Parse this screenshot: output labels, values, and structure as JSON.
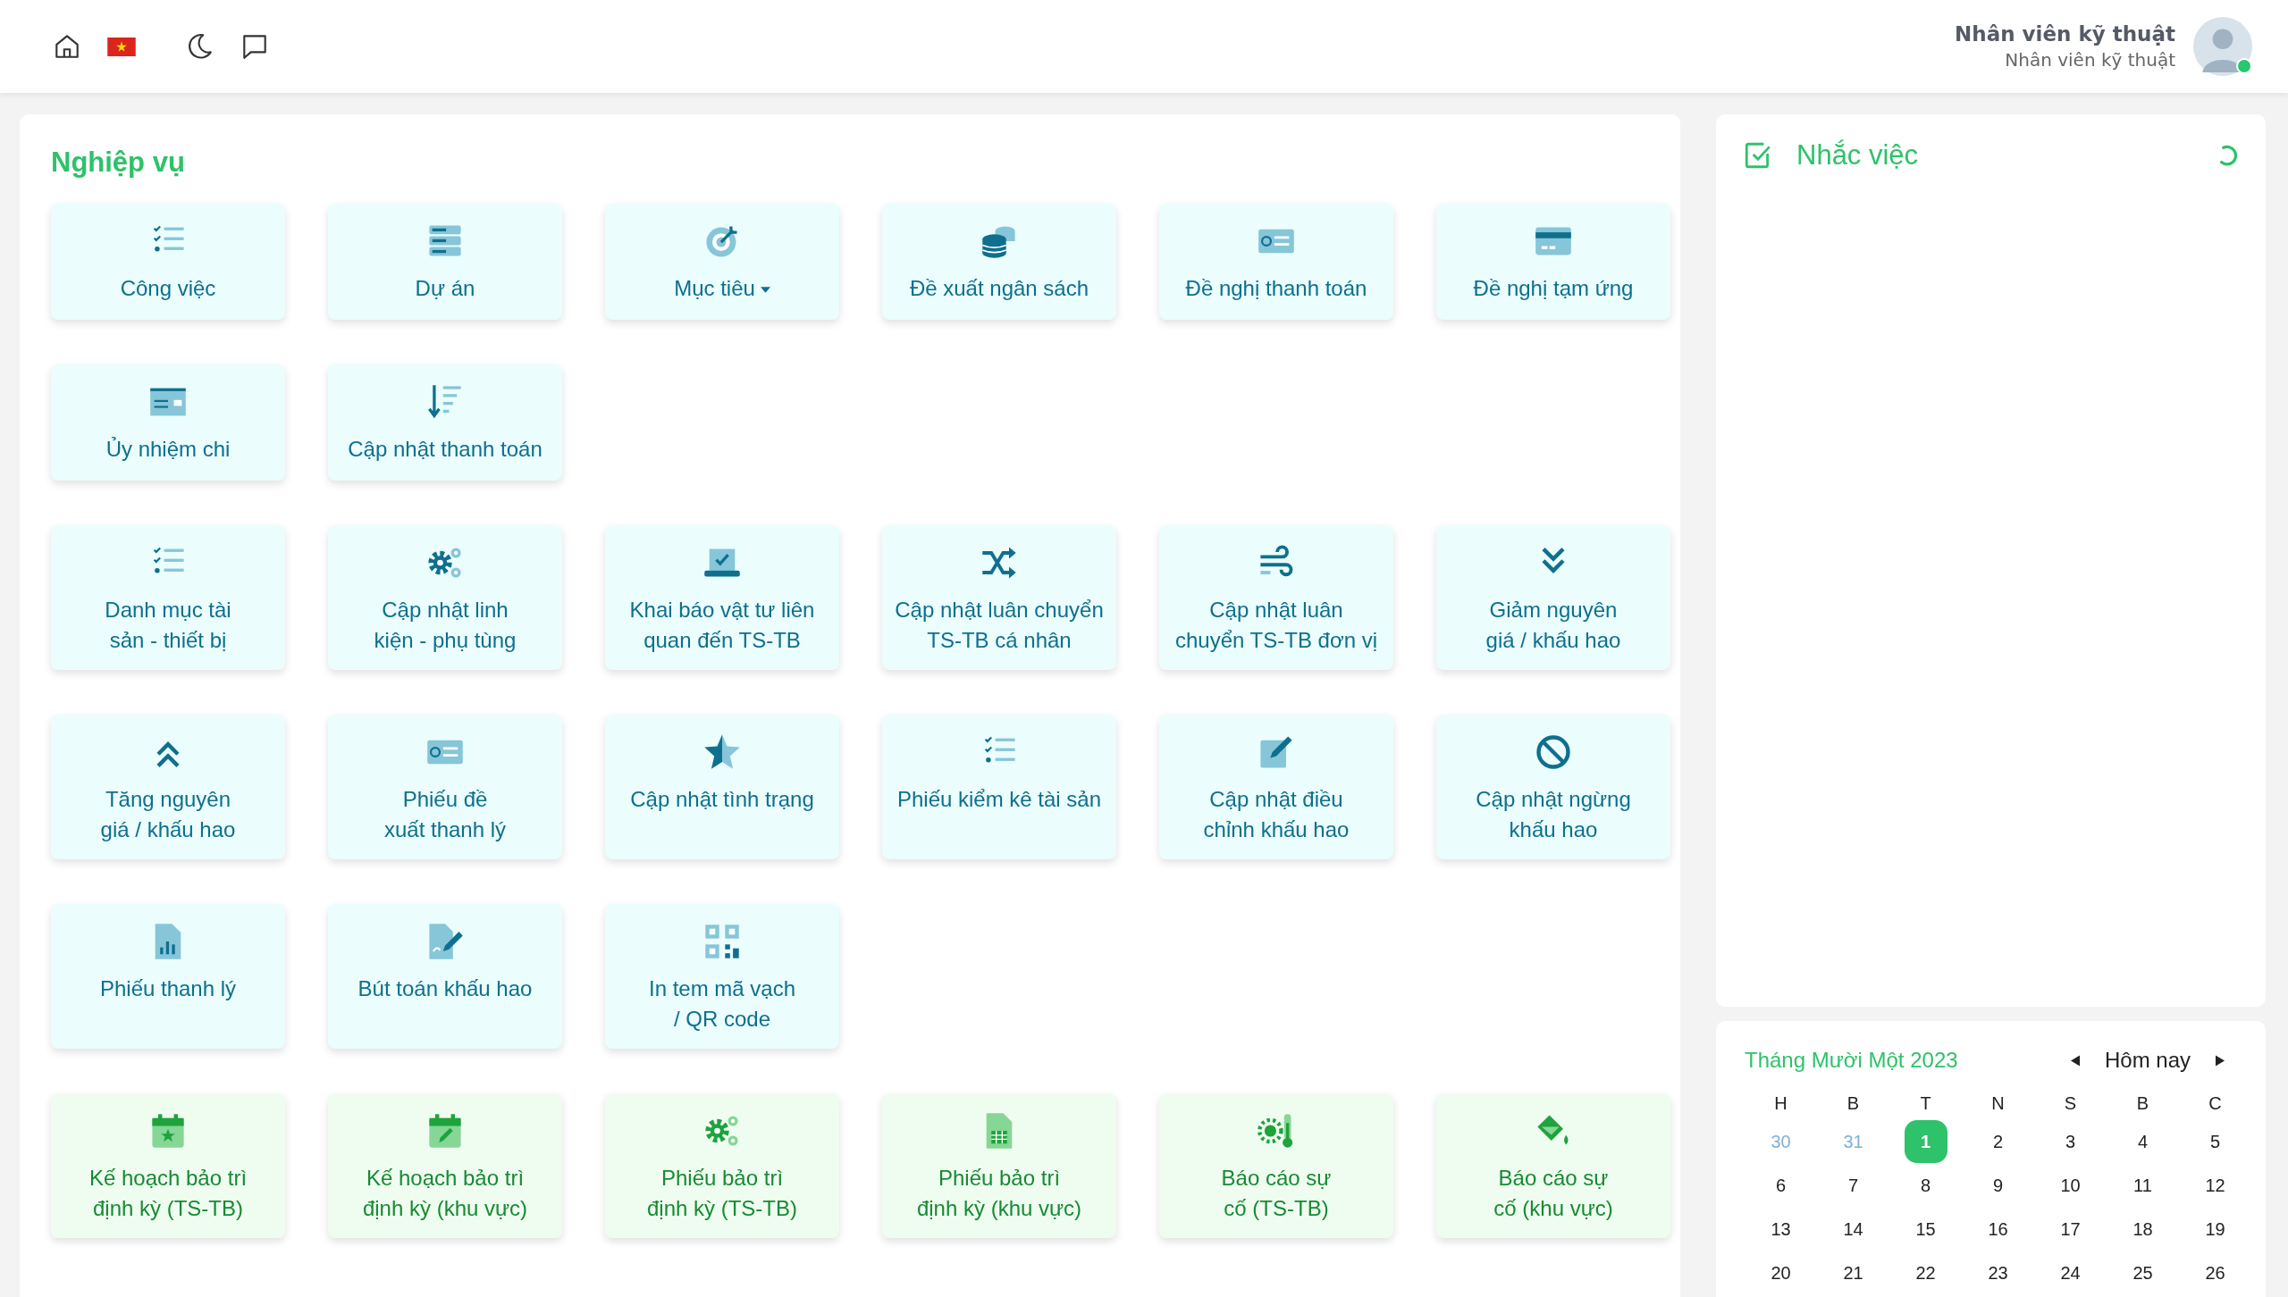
{
  "header": {
    "user_name": "Nhân viên kỹ thuật",
    "user_role": "Nhân viên kỹ thuật",
    "online": true
  },
  "main": {
    "title": "Nghiệp vụ",
    "groups": [
      {
        "kind": "finance",
        "tiles": [
          {
            "label": "Công việc",
            "dropdown": false
          },
          {
            "label": "Dự án",
            "dropdown": false
          },
          {
            "label": "Mục tiêu",
            "dropdown": true
          },
          {
            "label": "Đề xuất ngân sách",
            "dropdown": false
          },
          {
            "label": "Đề nghị thanh toán",
            "dropdown": false
          },
          {
            "label": "Đề nghị tạm ứng",
            "dropdown": false
          },
          {
            "label": "Ủy nhiệm chi",
            "dropdown": false
          },
          {
            "label": "Cập nhật thanh toán",
            "dropdown": false
          }
        ]
      },
      {
        "kind": "asset",
        "tiles": [
          {
            "label": "Danh mục tài\nsản - thiết bị",
            "dropdown": false
          },
          {
            "label": "Cập nhật linh\nkiện - phụ tùng",
            "dropdown": false
          },
          {
            "label": "Khai báo vật tư liên\nquan đến TS-TB",
            "dropdown": false
          },
          {
            "label": "Cập nhật luân chuyển\nTS-TB cá nhân",
            "dropdown": false
          },
          {
            "label": "Cập nhật luân\nchuyển TS-TB đơn vị",
            "dropdown": false
          },
          {
            "label": "Giảm nguyên\ngiá / khấu hao",
            "dropdown": false
          },
          {
            "label": "Tăng nguyên\ngiá / khấu hao",
            "dropdown": false
          },
          {
            "label": "Phiếu đề\nxuất thanh lý",
            "dropdown": false
          },
          {
            "label": "Cập nhật tình trạng",
            "dropdown": false
          },
          {
            "label": "Phiếu kiểm kê tài sản",
            "dropdown": false
          },
          {
            "label": "Cập nhật điều\nchỉnh khấu hao",
            "dropdown": false
          },
          {
            "label": "Cập nhật ngừng\nkhấu hao",
            "dropdown": false
          },
          {
            "label": "Phiếu thanh lý",
            "dropdown": false
          },
          {
            "label": "Bút toán khấu hao",
            "dropdown": false
          },
          {
            "label": "In tem mã vạch\n/ QR code",
            "dropdown": false
          }
        ]
      },
      {
        "kind": "maintenance",
        "tiles": [
          {
            "label": "Kế hoạch bảo trì\nđịnh kỳ (TS-TB)",
            "dropdown": false
          },
          {
            "label": "Kế hoạch bảo trì\nđịnh kỳ (khu vực)",
            "dropdown": false
          },
          {
            "label": "Phiếu bảo trì\nđịnh kỳ (TS-TB)",
            "dropdown": false
          },
          {
            "label": "Phiếu bảo trì\nđịnh kỳ (khu vực)",
            "dropdown": false
          },
          {
            "label": "Báo cáo sự\ncố (TS-TB)",
            "dropdown": false
          },
          {
            "label": "Báo cáo sự\ncố (khu vực)",
            "dropdown": false
          }
        ]
      }
    ]
  },
  "reminders": {
    "title": "Nhắc việc"
  },
  "calendar": {
    "month": "Tháng Mười Một 2023",
    "today_button": "Hôm nay",
    "weekdays": [
      "H",
      "B",
      "T",
      "N",
      "S",
      "B",
      "C"
    ],
    "weeks": [
      [
        {
          "day": "30",
          "muted": true,
          "selected": false
        },
        {
          "day": "31",
          "muted": true,
          "selected": false
        },
        {
          "day": "1",
          "muted": false,
          "selected": true
        },
        {
          "day": "2",
          "muted": false,
          "selected": false
        },
        {
          "day": "3",
          "muted": false,
          "selected": false
        },
        {
          "day": "4",
          "muted": false,
          "selected": false
        },
        {
          "day": "5",
          "muted": false,
          "selected": false
        }
      ],
      [
        {
          "day": "6",
          "muted": false,
          "selected": false
        },
        {
          "day": "7",
          "muted": false,
          "selected": false
        },
        {
          "day": "8",
          "muted": false,
          "selected": false
        },
        {
          "day": "9",
          "muted": false,
          "selected": false
        },
        {
          "day": "10",
          "muted": false,
          "selected": false
        },
        {
          "day": "11",
          "muted": false,
          "selected": false
        },
        {
          "day": "12",
          "muted": false,
          "selected": false
        }
      ],
      [
        {
          "day": "13",
          "muted": false,
          "selected": false
        },
        {
          "day": "14",
          "muted": false,
          "selected": false
        },
        {
          "day": "15",
          "muted": false,
          "selected": false
        },
        {
          "day": "16",
          "muted": false,
          "selected": false
        },
        {
          "day": "17",
          "muted": false,
          "selected": false
        },
        {
          "day": "18",
          "muted": false,
          "selected": false
        },
        {
          "day": "19",
          "muted": false,
          "selected": false
        }
      ],
      [
        {
          "day": "20",
          "muted": false,
          "selected": false
        },
        {
          "day": "21",
          "muted": false,
          "selected": false
        },
        {
          "day": "22",
          "muted": false,
          "selected": false
        },
        {
          "day": "23",
          "muted": false,
          "selected": false
        },
        {
          "day": "24",
          "muted": false,
          "selected": false
        },
        {
          "day": "25",
          "muted": false,
          "selected": false
        },
        {
          "day": "26",
          "muted": false,
          "selected": false
        }
      ]
    ]
  }
}
